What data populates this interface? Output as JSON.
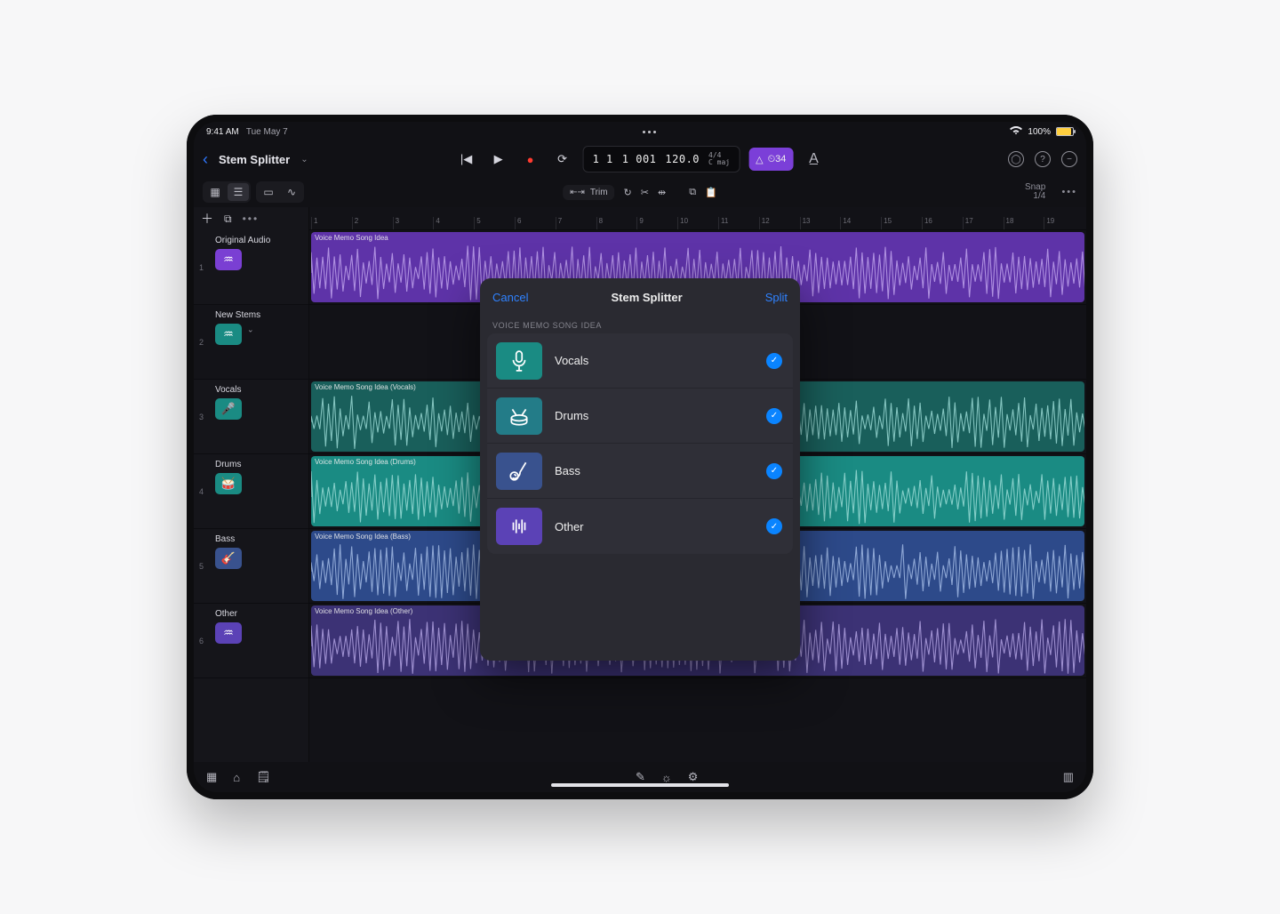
{
  "status": {
    "time": "9:41 AM",
    "date": "Tue May 7",
    "battery_pct": "100%"
  },
  "project": {
    "title": "Stem Splitter"
  },
  "lcd": {
    "bars": "1 1",
    "beats": "1 001",
    "tempo": "120.0",
    "sig": "4/4",
    "key": "C maj",
    "metro": "⏲34"
  },
  "snap": {
    "label": "Snap",
    "value": "1/4"
  },
  "trim_label": "Trim",
  "track_groups": {
    "original": {
      "label": "Original Audio",
      "number": "1"
    },
    "stems_group": {
      "label": "New Stems",
      "number": "2"
    }
  },
  "tracks": [
    {
      "number": "3",
      "name": "Vocals",
      "clip": "Voice Memo Song Idea (Vocals)",
      "color": "teal"
    },
    {
      "number": "4",
      "name": "Drums",
      "clip": "Voice Memo Song Idea (Drums)",
      "color": "drum"
    },
    {
      "number": "5",
      "name": "Bass",
      "clip": "Voice Memo Song Idea (Bass)",
      "color": "blue"
    },
    {
      "number": "6",
      "name": "Other",
      "clip": "Voice Memo Song Idea (Other)",
      "color": "other"
    }
  ],
  "original_clip": "Voice Memo Song Idea",
  "ruler": [
    "1",
    "2",
    "3",
    "4",
    "5",
    "6",
    "7",
    "8",
    "9",
    "10",
    "11",
    "12",
    "13",
    "14",
    "15",
    "16",
    "17",
    "18",
    "19"
  ],
  "modal": {
    "title": "Stem Splitter",
    "cancel": "Cancel",
    "action": "Split",
    "subtitle": "VOICE MEMO SONG IDEA",
    "items": [
      {
        "name": "Vocals",
        "color": "teal",
        "icon": "mic"
      },
      {
        "name": "Drums",
        "color": "drum",
        "icon": "drums"
      },
      {
        "name": "Bass",
        "color": "blue",
        "icon": "bass"
      },
      {
        "name": "Other",
        "color": "other",
        "icon": "wave"
      }
    ]
  }
}
